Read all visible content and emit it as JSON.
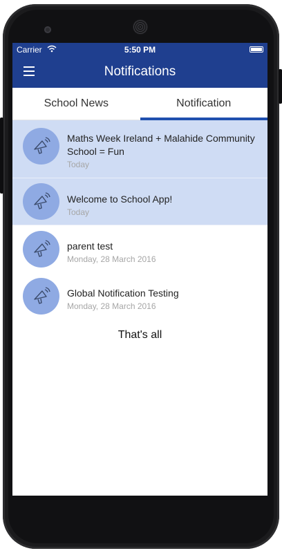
{
  "status": {
    "carrier": "Carrier",
    "time": "5:50 PM"
  },
  "navbar": {
    "title": "Notifications"
  },
  "tabs": [
    {
      "label": "School News"
    },
    {
      "label": "Notification"
    }
  ],
  "notifications": [
    {
      "title": "Maths Week Ireland + Malahide Community School = Fun",
      "date": "Today"
    },
    {
      "title": "Welcome to School App!",
      "date": "Today"
    },
    {
      "title": "parent test",
      "date": "Monday, 28 March 2016"
    },
    {
      "title": "Global Notification Testing",
      "date": "Monday, 28 March 2016"
    }
  ],
  "footer": "That's all",
  "colors": {
    "primary": "#1f3f8f",
    "tab_indicator": "#1f4fae",
    "unread_bg": "#cfdcf4",
    "avatar_bg": "#8faae3"
  },
  "icons": {
    "menu": "hamburger-menu-icon",
    "notification": "megaphone-icon",
    "wifi": "wifi-icon",
    "battery": "battery-icon"
  }
}
